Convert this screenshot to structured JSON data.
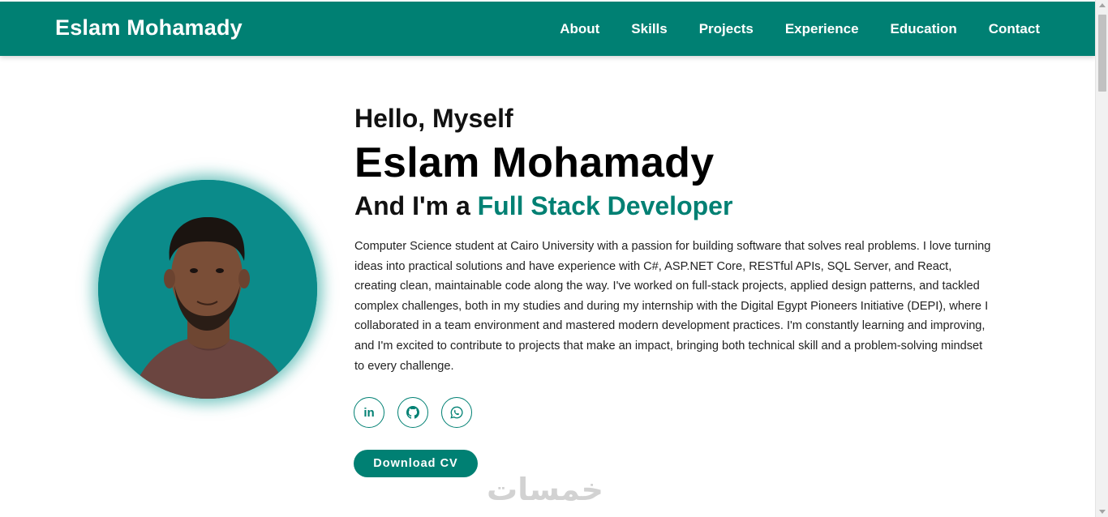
{
  "header": {
    "brand": "Eslam Mohamady",
    "nav": [
      "About",
      "Skills",
      "Projects",
      "Experience",
      "Education",
      "Contact"
    ]
  },
  "hero": {
    "greeting": "Hello, Myself",
    "name": "Eslam Mohamady",
    "role_prefix": "And I'm a ",
    "role_highlight": "Full Stack Developer",
    "bio": "Computer Science student at Cairo University with a passion for building software that solves real problems. I love turning ideas into practical solutions and have experience with C#, ASP.NET Core, RESTful APIs, SQL Server, and React, creating clean, maintainable code along the way. I've worked on full-stack projects, applied design patterns, and tackled complex challenges, both in my studies and during my internship with the Digital Egypt Pioneers Initiative (DEPI), where I collaborated in a team environment and mastered modern development practices. I'm constantly learning and improving, and I'm excited to contribute to projects that make an impact, bringing both technical skill and a problem-solving mindset to every challenge.",
    "socials": [
      {
        "icon": "linkedin-icon"
      },
      {
        "icon": "github-icon"
      },
      {
        "icon": "whatsapp-icon"
      }
    ],
    "cv_button": "Download CV"
  },
  "watermark": "خمسات",
  "colors": {
    "primary": "#008073",
    "avatar_bg": "#0b8b8a"
  }
}
